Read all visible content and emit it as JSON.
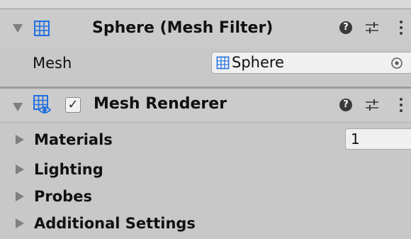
{
  "mesh_filter": {
    "title": "Sphere (Mesh Filter)",
    "icon": "mesh-grid-icon",
    "help_glyph": "?",
    "mesh_label": "Mesh",
    "mesh_value": "Sphere",
    "mesh_value_icon": "mesh-grid-icon"
  },
  "mesh_renderer": {
    "title": "Mesh Renderer",
    "icon": "mesh-renderer-eye-icon",
    "enabled": true,
    "check_glyph": "✓",
    "help_glyph": "?",
    "sections": [
      {
        "label": "Materials",
        "value": "1"
      },
      {
        "label": "Lighting"
      },
      {
        "label": "Probes"
      },
      {
        "label": "Additional Settings"
      }
    ]
  },
  "colors": {
    "background": "#c8c8c8",
    "header": "#cbcbcb",
    "field": "#f0f0f0",
    "icon_blue": "#1f6fe0",
    "arrow_gray": "#7f7f7f"
  }
}
